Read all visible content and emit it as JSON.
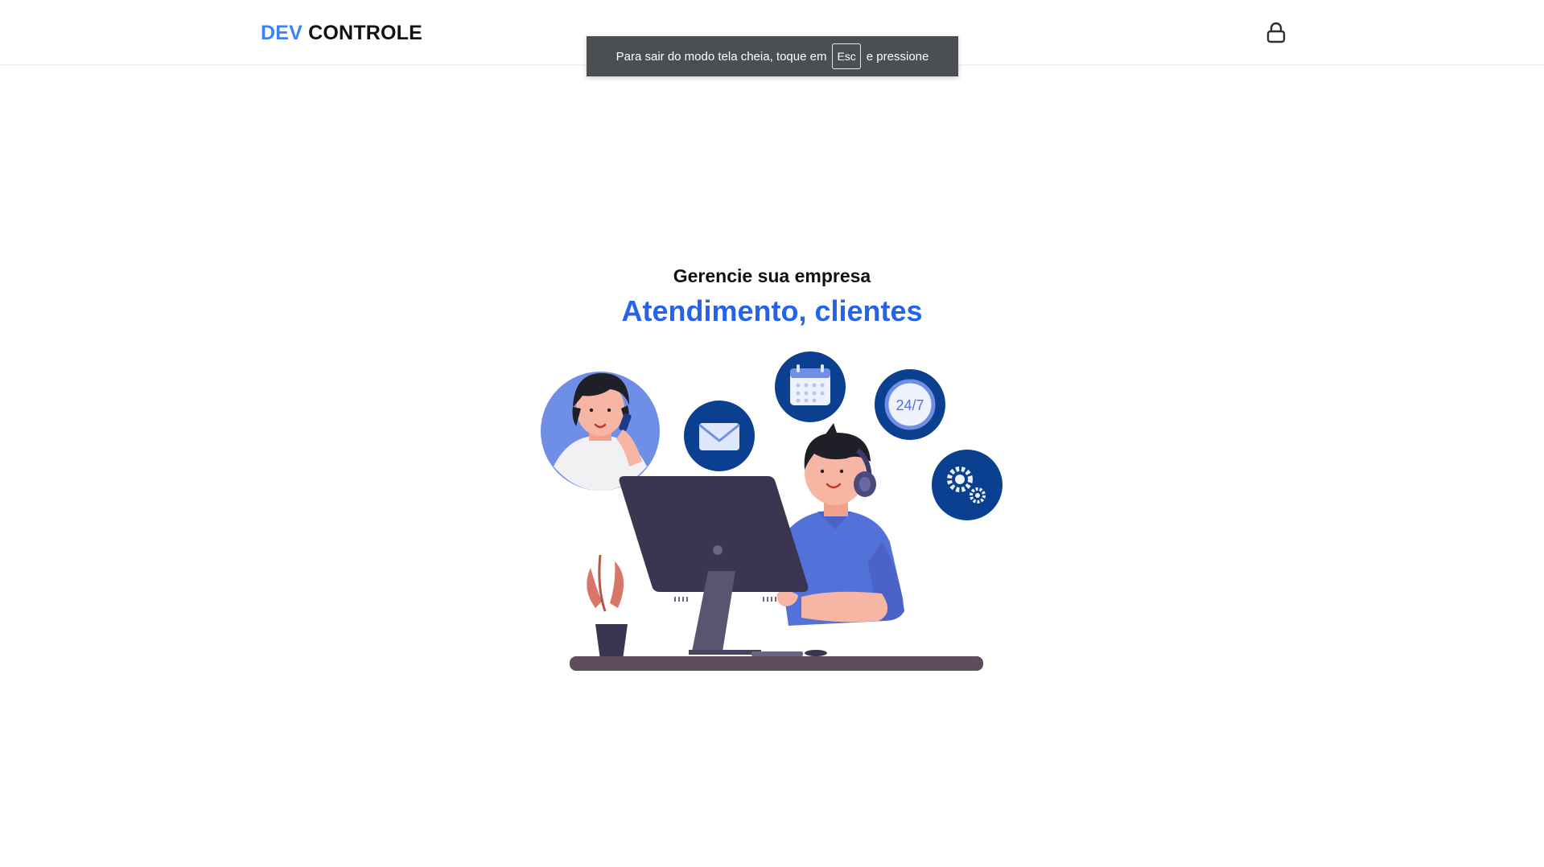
{
  "header": {
    "logo_accent": "DEV",
    "logo_rest": " CONTROLE",
    "login_icon": "lock-icon"
  },
  "fullscreen_notice": {
    "text_before": "Para sair do modo tela cheia, toque em",
    "key": "Esc",
    "text_after": "e pressione"
  },
  "hero": {
    "subtitle": "Gerencie sua empresa",
    "title": "Atendimento, clientes",
    "badge_247": "24/7"
  },
  "colors": {
    "accent": "#3b82f6",
    "title_blue": "#2563eb",
    "navy_circle": "#0b3f8f",
    "shirt_blue": "#5271d9"
  }
}
